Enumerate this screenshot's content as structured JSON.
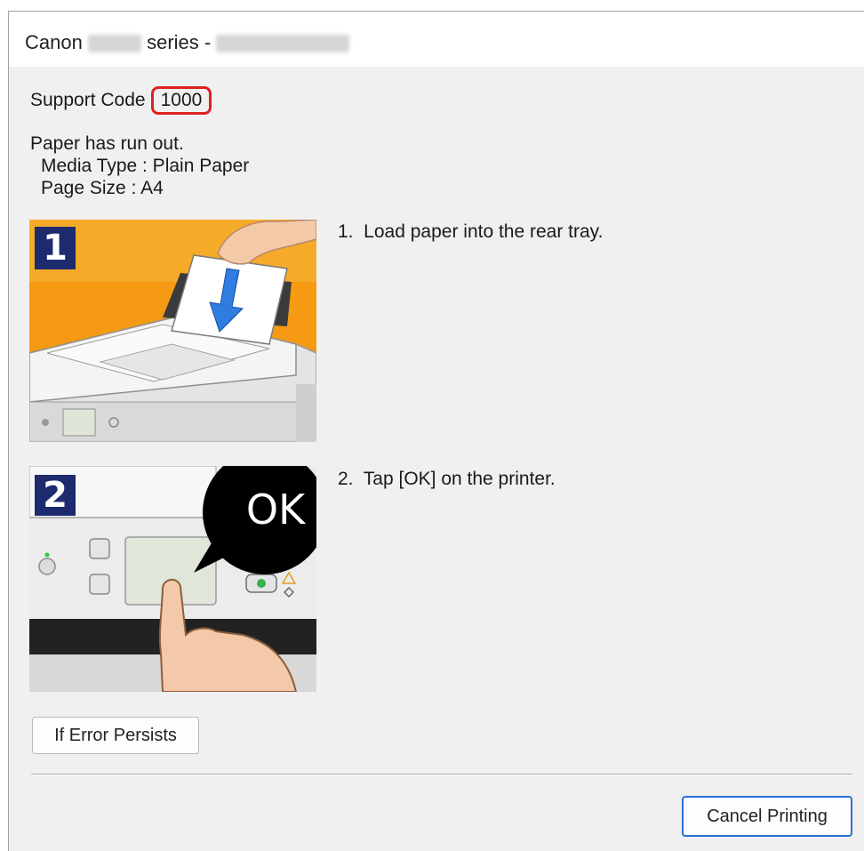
{
  "window": {
    "title_prefix": "Canon",
    "title_middle": "series -"
  },
  "support": {
    "label": "Support Code",
    "code": "1000"
  },
  "message": {
    "line1": "Paper has run out.",
    "line2": "Media Type : Plain Paper",
    "line3": "Page Size : A4"
  },
  "steps": [
    {
      "badge": "1",
      "text": "1.  Load paper into the rear tray."
    },
    {
      "badge": "2",
      "text": "2.  Tap [OK] on the printer.",
      "callout": "OK"
    }
  ],
  "buttons": {
    "if_error": "If Error Persists",
    "cancel": "Cancel Printing"
  },
  "colors": {
    "highlight": "#e02020",
    "primary_border": "#2a6fd6",
    "step1_bg": "#f59a12",
    "badge_bg": "#1e2b6e"
  }
}
